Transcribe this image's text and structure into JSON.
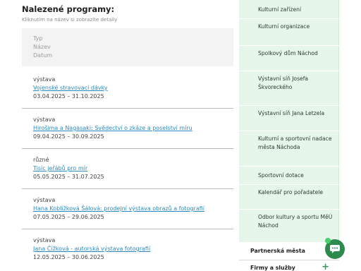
{
  "heading": "Nalezené programy:",
  "hint": "Kliknutím na název si zobrazíte detaily",
  "table": {
    "headers": [
      "Typ",
      "Název",
      "Datum"
    ],
    "rows": [
      {
        "type": "výstava",
        "name": "Vojenské stravovací dávky",
        "date": "03.04.2025 – 31.10.2025"
      },
      {
        "type": "výstava",
        "name": "Hirošima a Nagasaki: Svědectví o zkáze a poselství míru",
        "date": "09.04.2025 – 30.09.2025"
      },
      {
        "type": "různé",
        "name": "Tisíc jeřábů pro mír",
        "date": "05.05.2025 – 31.07.2025"
      },
      {
        "type": "výstava",
        "name": "Hana Koblížková Šálová: prodejní výstava obrazů a fotografií",
        "date": "07.05.2025 – 29.06.2025"
      },
      {
        "type": "výstava",
        "name": "Jana Čížková - autorská výstava fotografií",
        "date": "12.05.2025 – 30.06.2025"
      }
    ]
  },
  "sidebar": {
    "items": [
      {
        "label": "Kulturní zařízení"
      },
      {
        "label": "Kulturní organizace"
      },
      {
        "label": "Spolkový dům Náchod"
      },
      {
        "label": "Výstavní síň Josefa Škvoreckého"
      },
      {
        "label": "Výstavní síň Jana Letzela"
      },
      {
        "label": "Kulturní a sportovní nadace města Náchoda"
      },
      {
        "label": "Sportovní dotace"
      },
      {
        "label": "Kalendář pro pořadatele"
      },
      {
        "label": "Odbor kultury a sportu MěÚ Náchod"
      }
    ],
    "sections": [
      {
        "label": "Partnerská města"
      },
      {
        "label": "Firmy a služby",
        "expand_icon": "plus-icon"
      }
    ]
  },
  "chat": {
    "icon": "chat-icon",
    "color": "#2c8a4c"
  }
}
